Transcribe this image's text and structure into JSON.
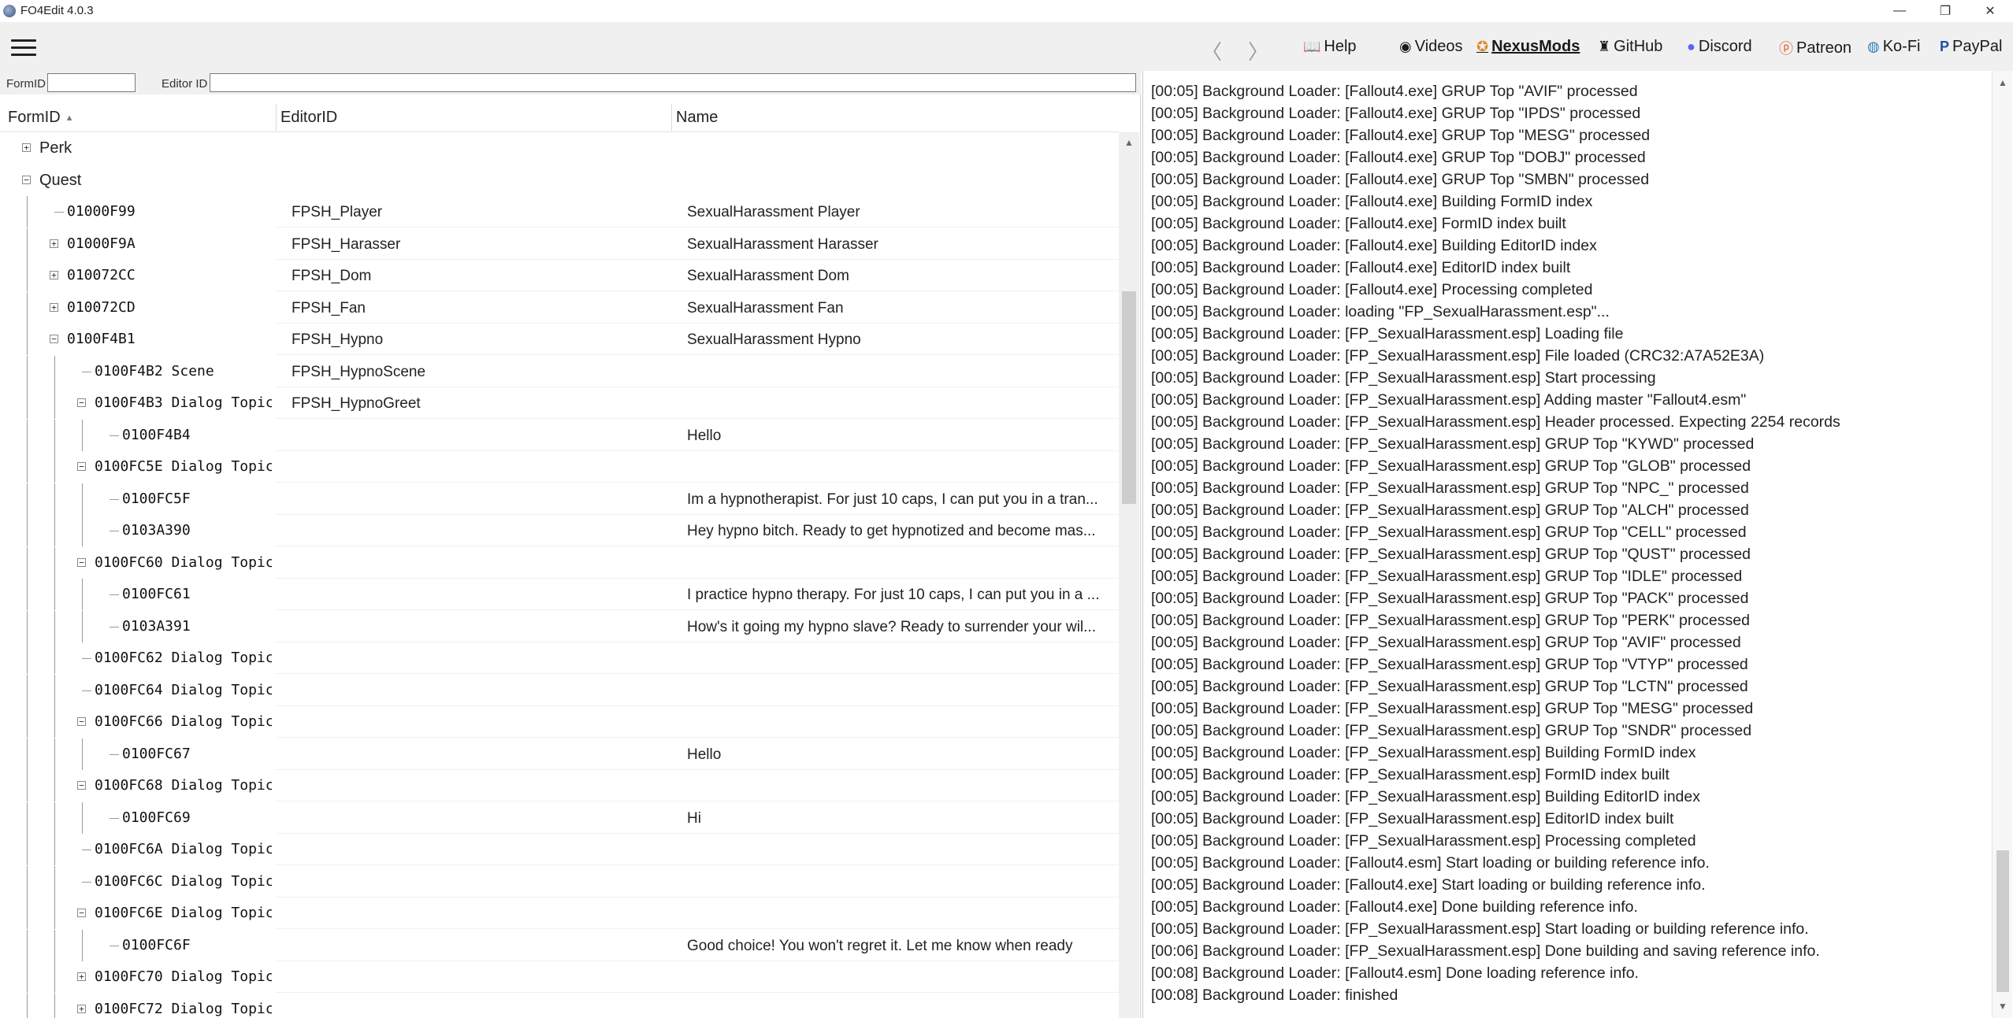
{
  "window": {
    "title": "FO4Edit 4.0.3",
    "minimize_glyph": "—",
    "maximize_glyph": "❐",
    "close_glyph": "✕"
  },
  "toolbar": {
    "back_glyph": "〈",
    "forward_glyph": "〉",
    "links": {
      "help": "Help",
      "videos": "Videos",
      "nexusmods": "NexusMods",
      "github": "GitHub",
      "discord": "Discord",
      "patreon": "Patreon",
      "kofi": "Ko-Fi",
      "paypal": "PayPal"
    }
  },
  "filters": {
    "formid_label": "FormID",
    "formid_value": "",
    "editorid_label": "Editor ID",
    "editorid_value": ""
  },
  "tree": {
    "columns": {
      "formid": "FormID",
      "editorid": "EditorID",
      "name": "Name"
    },
    "sort_glyph": "▲",
    "rows": [
      {
        "depth": 1,
        "expander": "+",
        "kind": "group",
        "formid": "Perk",
        "editorid": "",
        "name": ""
      },
      {
        "depth": 1,
        "expander": "-",
        "kind": "group",
        "formid": "Quest",
        "editorid": "",
        "name": ""
      },
      {
        "depth": 2,
        "expander": "",
        "kind": "record",
        "formid": "01000F99",
        "editorid": "FPSH_Player",
        "name": "SexualHarassment Player"
      },
      {
        "depth": 2,
        "expander": "+",
        "kind": "record",
        "formid": "01000F9A",
        "editorid": "FPSH_Harasser",
        "name": "SexualHarassment Harasser"
      },
      {
        "depth": 2,
        "expander": "+",
        "kind": "record",
        "formid": "010072CC",
        "editorid": "FPSH_Dom",
        "name": "SexualHarassment Dom"
      },
      {
        "depth": 2,
        "expander": "+",
        "kind": "record",
        "formid": "010072CD",
        "editorid": "FPSH_Fan",
        "name": "SexualHarassment Fan"
      },
      {
        "depth": 2,
        "expander": "-",
        "kind": "record",
        "formid": "0100F4B1",
        "editorid": "FPSH_Hypno",
        "name": "SexualHarassment Hypno"
      },
      {
        "depth": 3,
        "expander": "",
        "kind": "record",
        "formid": "0100F4B2 Scene",
        "editorid": "FPSH_HypnoScene",
        "name": ""
      },
      {
        "depth": 3,
        "expander": "-",
        "kind": "record",
        "formid": "0100F4B3 Dialog Topic",
        "editorid": "FPSH_HypnoGreet",
        "name": ""
      },
      {
        "depth": 4,
        "expander": "",
        "kind": "record",
        "formid": "0100F4B4",
        "editorid": "",
        "name": "Hello"
      },
      {
        "depth": 3,
        "expander": "-",
        "kind": "record",
        "formid": "0100FC5E Dialog Topic",
        "editorid": "",
        "name": ""
      },
      {
        "depth": 4,
        "expander": "",
        "kind": "record",
        "formid": "0100FC5F",
        "editorid": "",
        "name": "Im a hypnotherapist. For just 10 caps, I can put you in a tran..."
      },
      {
        "depth": 4,
        "expander": "",
        "kind": "record",
        "formid": "0103A390",
        "editorid": "",
        "name": "Hey hypno bitch. Ready to get hypnotized and become mas..."
      },
      {
        "depth": 3,
        "expander": "-",
        "kind": "record",
        "formid": "0100FC60 Dialog Topic",
        "editorid": "",
        "name": ""
      },
      {
        "depth": 4,
        "expander": "",
        "kind": "record",
        "formid": "0100FC61",
        "editorid": "",
        "name": "I practice hypno therapy. For just 10 caps, I can put you in a ..."
      },
      {
        "depth": 4,
        "expander": "",
        "kind": "record",
        "formid": "0103A391",
        "editorid": "",
        "name": "How's it going my hypno slave? Ready to surrender your wil..."
      },
      {
        "depth": 3,
        "expander": "",
        "kind": "record",
        "formid": "0100FC62 Dialog Topic",
        "editorid": "",
        "name": ""
      },
      {
        "depth": 3,
        "expander": "",
        "kind": "record",
        "formid": "0100FC64 Dialog Topic",
        "editorid": "",
        "name": ""
      },
      {
        "depth": 3,
        "expander": "-",
        "kind": "record",
        "formid": "0100FC66 Dialog Topic",
        "editorid": "",
        "name": ""
      },
      {
        "depth": 4,
        "expander": "",
        "kind": "record",
        "formid": "0100FC67",
        "editorid": "",
        "name": "Hello"
      },
      {
        "depth": 3,
        "expander": "-",
        "kind": "record",
        "formid": "0100FC68 Dialog Topic",
        "editorid": "",
        "name": ""
      },
      {
        "depth": 4,
        "expander": "",
        "kind": "record",
        "formid": "0100FC69",
        "editorid": "",
        "name": "Hi"
      },
      {
        "depth": 3,
        "expander": "",
        "kind": "record",
        "formid": "0100FC6A Dialog Topic",
        "editorid": "",
        "name": ""
      },
      {
        "depth": 3,
        "expander": "",
        "kind": "record",
        "formid": "0100FC6C Dialog Topic",
        "editorid": "",
        "name": ""
      },
      {
        "depth": 3,
        "expander": "-",
        "kind": "record",
        "formid": "0100FC6E Dialog Topic",
        "editorid": "",
        "name": ""
      },
      {
        "depth": 4,
        "expander": "",
        "kind": "record",
        "formid": "0100FC6F",
        "editorid": "",
        "name": "Good choice! You won't regret it. Let me know when ready"
      },
      {
        "depth": 3,
        "expander": "+",
        "kind": "record",
        "formid": "0100FC70 Dialog Topic",
        "editorid": "",
        "name": ""
      },
      {
        "depth": 3,
        "expander": "+",
        "kind": "record",
        "formid": "0100FC72 Dialog Topic",
        "editorid": "",
        "name": ""
      }
    ]
  },
  "log": {
    "lines": [
      "[00:05] Background Loader: [Fallout4.exe] GRUP Top \"AVIF\" processed",
      "[00:05] Background Loader: [Fallout4.exe] GRUP Top \"IPDS\" processed",
      "[00:05] Background Loader: [Fallout4.exe] GRUP Top \"MESG\" processed",
      "[00:05] Background Loader: [Fallout4.exe] GRUP Top \"DOBJ\" processed",
      "[00:05] Background Loader: [Fallout4.exe] GRUP Top \"SMBN\" processed",
      "[00:05] Background Loader: [Fallout4.exe] Building FormID index",
      "[00:05] Background Loader: [Fallout4.exe] FormID index built",
      "[00:05] Background Loader: [Fallout4.exe] Building EditorID index",
      "[00:05] Background Loader: [Fallout4.exe] EditorID index built",
      "[00:05] Background Loader: [Fallout4.exe] Processing completed",
      "[00:05] Background Loader: loading \"FP_SexualHarassment.esp\"...",
      "[00:05] Background Loader: [FP_SexualHarassment.esp] Loading file",
      "[00:05] Background Loader: [FP_SexualHarassment.esp] File loaded (CRC32:A7A52E3A)",
      "[00:05] Background Loader: [FP_SexualHarassment.esp] Start processing",
      "[00:05] Background Loader: [FP_SexualHarassment.esp] Adding master \"Fallout4.esm\"",
      "[00:05] Background Loader: [FP_SexualHarassment.esp] Header processed. Expecting 2254 records",
      "[00:05] Background Loader: [FP_SexualHarassment.esp] GRUP Top \"KYWD\" processed",
      "[00:05] Background Loader: [FP_SexualHarassment.esp] GRUP Top \"GLOB\" processed",
      "[00:05] Background Loader: [FP_SexualHarassment.esp] GRUP Top \"NPC_\" processed",
      "[00:05] Background Loader: [FP_SexualHarassment.esp] GRUP Top \"ALCH\" processed",
      "[00:05] Background Loader: [FP_SexualHarassment.esp] GRUP Top \"CELL\" processed",
      "[00:05] Background Loader: [FP_SexualHarassment.esp] GRUP Top \"QUST\" processed",
      "[00:05] Background Loader: [FP_SexualHarassment.esp] GRUP Top \"IDLE\" processed",
      "[00:05] Background Loader: [FP_SexualHarassment.esp] GRUP Top \"PACK\" processed",
      "[00:05] Background Loader: [FP_SexualHarassment.esp] GRUP Top \"PERK\" processed",
      "[00:05] Background Loader: [FP_SexualHarassment.esp] GRUP Top \"AVIF\" processed",
      "[00:05] Background Loader: [FP_SexualHarassment.esp] GRUP Top \"VTYP\" processed",
      "[00:05] Background Loader: [FP_SexualHarassment.esp] GRUP Top \"LCTN\" processed",
      "[00:05] Background Loader: [FP_SexualHarassment.esp] GRUP Top \"MESG\" processed",
      "[00:05] Background Loader: [FP_SexualHarassment.esp] GRUP Top \"SNDR\" processed",
      "[00:05] Background Loader: [FP_SexualHarassment.esp] Building FormID index",
      "[00:05] Background Loader: [FP_SexualHarassment.esp] FormID index built",
      "[00:05] Background Loader: [FP_SexualHarassment.esp] Building EditorID index",
      "[00:05] Background Loader: [FP_SexualHarassment.esp] EditorID index built",
      "[00:05] Background Loader: [FP_SexualHarassment.esp] Processing completed",
      "[00:05] Background Loader: [Fallout4.esm] Start loading or building reference info.",
      "[00:05] Background Loader: [Fallout4.exe] Start loading or building reference info.",
      "[00:05] Background Loader: [Fallout4.exe] Done building reference info.",
      "[00:05] Background Loader: [FP_SexualHarassment.esp] Start loading or building reference info.",
      "[00:06] Background Loader: [FP_SexualHarassment.esp] Done building and saving reference info.",
      "[00:08] Background Loader: [Fallout4.esm] Done loading reference info.",
      "[00:08] Background Loader: finished"
    ]
  }
}
